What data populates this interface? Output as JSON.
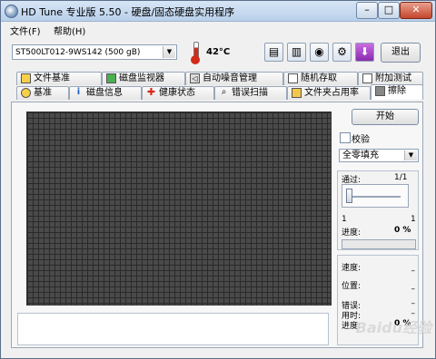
{
  "window": {
    "title": "HD Tune 专业版 5.50 - 硬盘/固态硬盘实用程序",
    "close_label": "✕",
    "min_label": "–",
    "max_label": "□"
  },
  "menu": {
    "file": "文件(F)",
    "help": "帮助(H)"
  },
  "toolbar": {
    "drive": "ST500LT012-9WS142 (500 gB)",
    "temperature": "42°C",
    "exit_label": "退出",
    "icons": [
      "copy-info-icon",
      "copy-screen-icon",
      "camera-icon",
      "options-icon",
      "download-icon"
    ]
  },
  "tabs_top": [
    {
      "label": "文件基准",
      "icon": "file-benchmark-icon"
    },
    {
      "label": "磁盘监视器",
      "icon": "disk-monitor-icon"
    },
    {
      "label": "自动噪音管理",
      "icon": "aam-icon"
    },
    {
      "label": "随机存取",
      "icon": "random-access-icon"
    },
    {
      "label": "附加测试",
      "icon": "extra-tests-icon"
    }
  ],
  "tabs_bottom": [
    {
      "label": "基准",
      "icon": "benchmark-icon"
    },
    {
      "label": "磁盘信息",
      "icon": "info-icon"
    },
    {
      "label": "健康状态",
      "icon": "health-icon"
    },
    {
      "label": "错误扫描",
      "icon": "error-scan-icon"
    },
    {
      "label": "文件夹占用率",
      "icon": "folder-usage-icon"
    },
    {
      "label": "擦除",
      "icon": "erase-icon"
    }
  ],
  "active_tab": "擦除",
  "erase": {
    "start_label": "开始",
    "verify_label": "校验",
    "verify_checked": false,
    "fill_mode": "全零填充",
    "pass_label": "通过:",
    "pass_value": "1/1",
    "slider_min": "1",
    "slider_max": "1",
    "progress_label": "进度:",
    "progress_value": "0 %",
    "progress_fraction": 0,
    "speed_label": "速度:",
    "position_label": "位置:",
    "errors_label": "错误:",
    "elapsed_label": "用时:",
    "progress2_label": "进度:",
    "dash": "–",
    "progress2_value": "0 %"
  },
  "colors": {
    "grid_cell": "#4a4a4a",
    "progress_fill": "#4bb34b",
    "title_gradient_top": "#d7e6f6"
  }
}
